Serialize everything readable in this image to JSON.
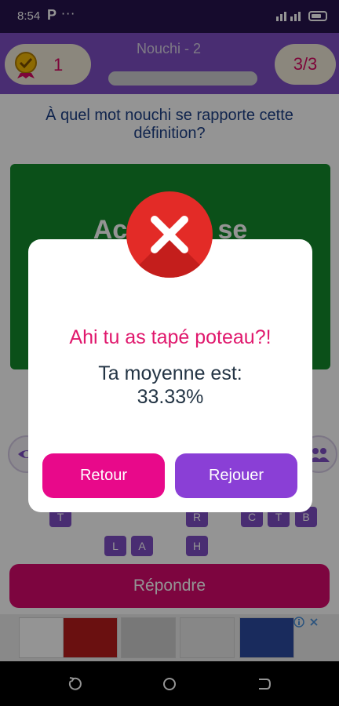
{
  "status_bar": {
    "time": "8:54",
    "app_badge": "P",
    "more": "···"
  },
  "header": {
    "score": "1",
    "level_title": "Nouchi - 2",
    "counter": "3/3",
    "progress": 1.0
  },
  "quiz": {
    "question": "À quel mot nouchi se rapporte cette définition?",
    "definition_visible": "Act        e se\nd                          u.",
    "letter_tiles": [
      "T",
      "R",
      "C",
      "T",
      "B",
      "L",
      "A",
      "H"
    ],
    "answer_button": "Répondre"
  },
  "dialog": {
    "title": "Ahi tu as tapé poteau?!",
    "average_label": "Ta moyenne est:",
    "average_value": "33.33%",
    "back_button": "Retour",
    "replay_button": "Rejouer"
  },
  "colors": {
    "status_bar": "#26134f",
    "header": "#7e4fc4",
    "accent_pink": "#d80a6d",
    "accent_purple": "#8a3fd6",
    "card_green": "#138a2c",
    "error_red": "#e32b27"
  },
  "icons": {
    "medal": "medal-icon",
    "error": "close-icon",
    "hint_left": "eye-icon",
    "hint_right": "group-icon"
  }
}
